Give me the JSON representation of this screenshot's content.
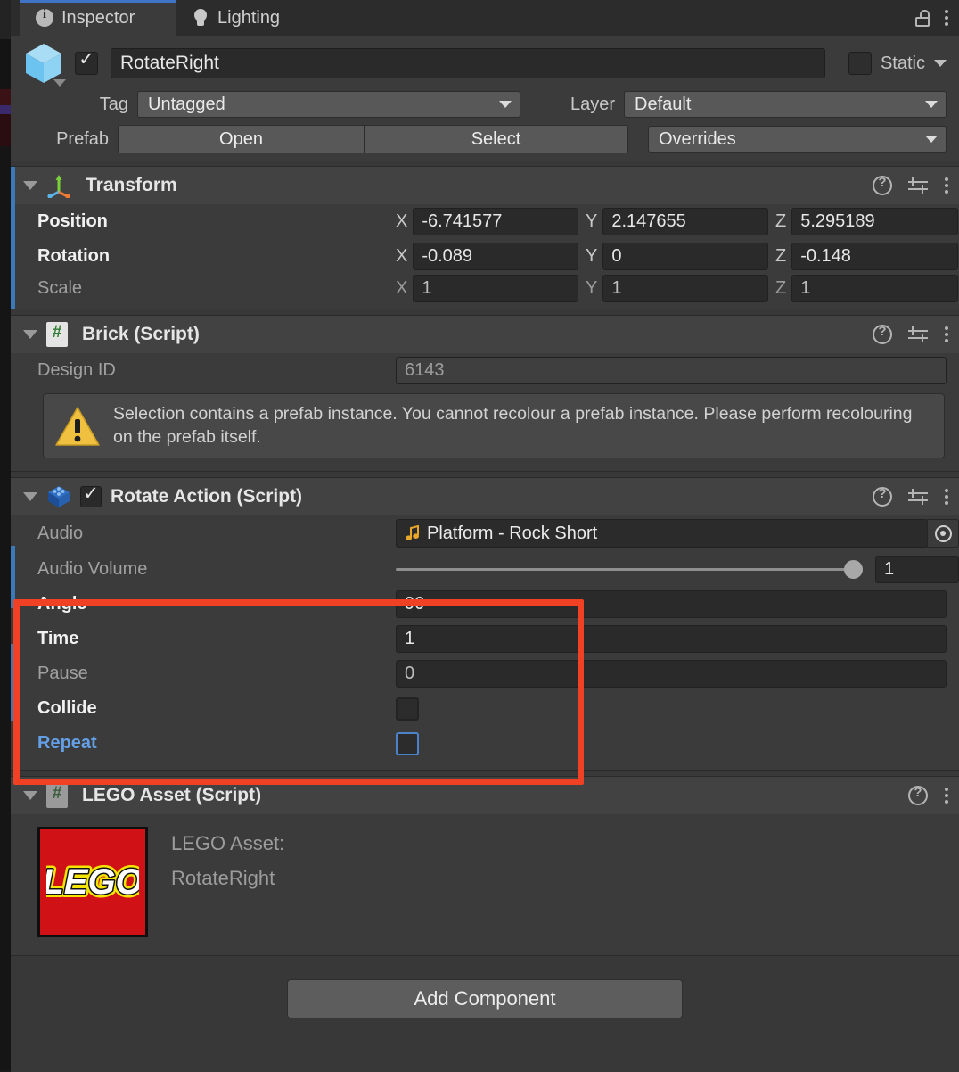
{
  "window": {
    "tabs": [
      {
        "label": "Inspector",
        "icon": "info-icon",
        "active": true
      },
      {
        "label": "Lighting",
        "icon": "bulb-icon",
        "active": false
      }
    ],
    "lock_icon": "unlocked-padlock-icon",
    "menu_icon": "kebab-menu-icon"
  },
  "object_header": {
    "icon": "prefab-cube-icon",
    "enabled": true,
    "name": "RotateRight",
    "static_label": "Static",
    "static_checked": false,
    "tag_label": "Tag",
    "tag_value": "Untagged",
    "layer_label": "Layer",
    "layer_value": "Default",
    "prefab_label": "Prefab",
    "prefab_open": "Open",
    "prefab_select": "Select",
    "prefab_overrides": "Overrides"
  },
  "transform": {
    "title": "Transform",
    "icon": "transform-axis-icon",
    "rows": [
      {
        "label": "Position",
        "overridden": true,
        "axes": [
          {
            "axis": "X",
            "value": "-6.741577"
          },
          {
            "axis": "Y",
            "value": "2.147655"
          },
          {
            "axis": "Z",
            "value": "5.295189"
          }
        ]
      },
      {
        "label": "Rotation",
        "overridden": true,
        "axes": [
          {
            "axis": "X",
            "value": "-0.089"
          },
          {
            "axis": "Y",
            "value": "0"
          },
          {
            "axis": "Z",
            "value": "-0.148"
          }
        ]
      },
      {
        "label": "Scale",
        "overridden": false,
        "axes": [
          {
            "axis": "X",
            "value": "1"
          },
          {
            "axis": "Y",
            "value": "1"
          },
          {
            "axis": "Z",
            "value": "1"
          }
        ]
      }
    ]
  },
  "brick": {
    "title": "Brick (Script)",
    "icon": "csharp-script-icon",
    "design_id_label": "Design ID",
    "design_id_value": "6143",
    "warning": {
      "icon": "warning-triangle-icon",
      "text": "Selection contains a prefab instance. You cannot recolour a prefab instance. Please perform recolouring on the prefab itself."
    }
  },
  "rotate_action": {
    "title": "Rotate Action (Script)",
    "icon": "lego-brick-icon",
    "enabled": true,
    "audio_label": "Audio",
    "audio_value": "Platform - Rock Short",
    "audio_icon": "audio-clip-note-icon",
    "picker_icon": "object-picker-icon",
    "volume_label": "Audio Volume",
    "volume_value": "1",
    "fields": [
      {
        "label": "Angle",
        "value": "90",
        "type": "number",
        "state": "overridden"
      },
      {
        "label": "Time",
        "value": "1",
        "type": "number",
        "state": "overridden"
      },
      {
        "label": "Pause",
        "value": "0",
        "type": "number",
        "state": "default"
      },
      {
        "label": "Collide",
        "value": "",
        "type": "checkbox",
        "state": "overridden",
        "checked": false
      },
      {
        "label": "Repeat",
        "value": "",
        "type": "checkbox",
        "state": "modified",
        "checked": false
      }
    ]
  },
  "lego_asset": {
    "title": "LEGO Asset (Script)",
    "icon": "csharp-script-icon",
    "logo_text": "LEGO",
    "caption_line1": "LEGO Asset:",
    "caption_line2": "RotateRight"
  },
  "footer": {
    "add_component": "Add Component"
  },
  "colors": {
    "accent_blue": "#3e73c8",
    "override_bar": "#3c79b8",
    "highlight_red": "#f04124",
    "warning_yellow": "#f0c040",
    "lego_red": "#d01217",
    "modified_label": "#63a0e8"
  }
}
